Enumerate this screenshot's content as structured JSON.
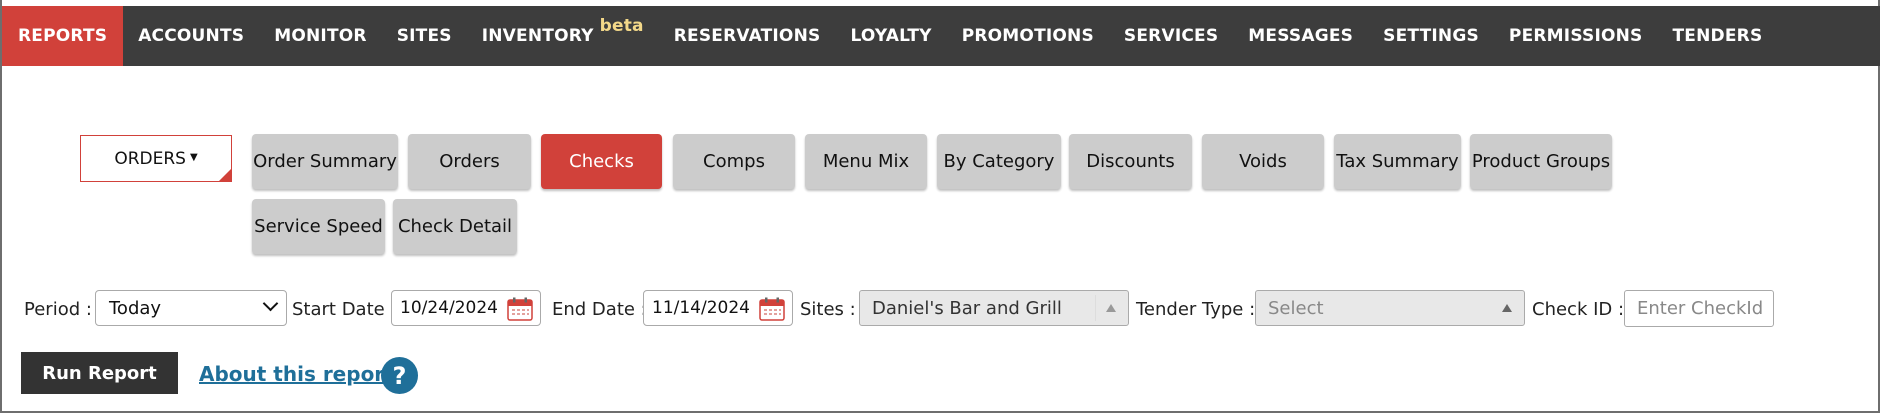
{
  "nav": {
    "items": [
      {
        "label": "REPORTS"
      },
      {
        "label": "ACCOUNTS"
      },
      {
        "label": "MONITOR"
      },
      {
        "label": "SITES"
      },
      {
        "label": "INVENTORY",
        "badge": "beta"
      },
      {
        "label": "RESERVATIONS"
      },
      {
        "label": "LOYALTY"
      },
      {
        "label": "PROMOTIONS"
      },
      {
        "label": "SERVICES"
      },
      {
        "label": "MESSAGES"
      },
      {
        "label": "SETTINGS"
      },
      {
        "label": "PERMISSIONS"
      },
      {
        "label": "TENDERS"
      }
    ],
    "active_index": 0
  },
  "category_dropdown": {
    "label": "ORDERS"
  },
  "report_tabs": [
    {
      "label": "Order Summary"
    },
    {
      "label": "Orders"
    },
    {
      "label": "Checks"
    },
    {
      "label": "Comps"
    },
    {
      "label": "Menu Mix"
    },
    {
      "label": "By Category"
    },
    {
      "label": "Discounts"
    },
    {
      "label": "Voids"
    },
    {
      "label": "Tax Summary"
    },
    {
      "label": "Product Groups"
    },
    {
      "label": "Service Speed"
    },
    {
      "label": "Check Detail"
    }
  ],
  "active_report": "Checks",
  "filters": {
    "period_label": "Period :",
    "period_value": "Today",
    "start_label": "Start Date :",
    "start_value": "10/24/2024",
    "end_label": "End Date :",
    "end_value": "11/14/2024",
    "sites_label": "Sites :",
    "sites_value": "Daniel's Bar and Grill",
    "tender_label": "Tender Type :",
    "tender_placeholder": "Select",
    "checkid_label": "Check ID :",
    "checkid_placeholder": "Enter CheckId"
  },
  "actions": {
    "run_label": "Run Report",
    "about_label": "About this report",
    "help_glyph": "?"
  },
  "colors": {
    "nav_bg": "#3d3d3d",
    "accent": "#d1413a",
    "tab_bg": "#cccccc",
    "link": "#1f6f99"
  }
}
